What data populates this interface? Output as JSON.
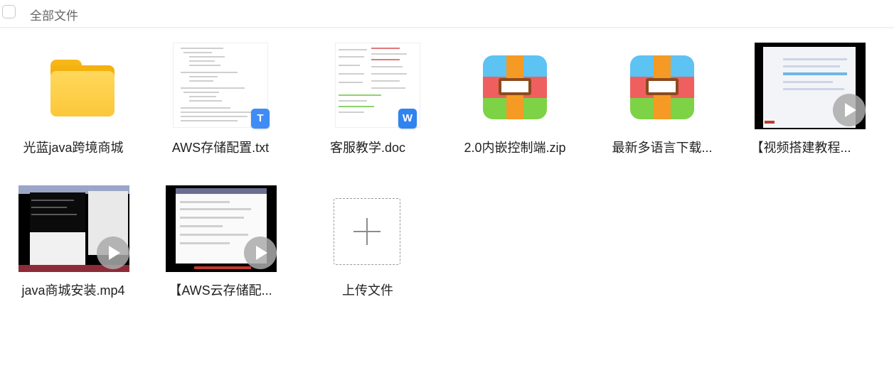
{
  "header": {
    "title": "全部文件"
  },
  "files": [
    {
      "name": "光蓝java跨境商城",
      "type": "folder",
      "icon": "folder-icon"
    },
    {
      "name": "AWS存储配置.txt",
      "type": "txt",
      "badge": "T"
    },
    {
      "name": "客服教学.doc",
      "type": "doc",
      "badge": "W"
    },
    {
      "name": "2.0内嵌控制端.zip",
      "type": "zip",
      "icon": "zip-icon"
    },
    {
      "name": "最新多语言下载...",
      "type": "zip",
      "icon": "zip-icon"
    },
    {
      "name": "【视频搭建教程...",
      "type": "video",
      "icon": "play-icon"
    },
    {
      "name": "java商城安装.mp4",
      "type": "video",
      "icon": "play-icon"
    },
    {
      "name": "【AWS云存储配...",
      "type": "video",
      "icon": "play-icon"
    }
  ],
  "upload": {
    "label": "上传文件"
  },
  "colors": {
    "folder": "#fcc73a",
    "badge_blue": "#3f8cf6",
    "zip_orange": "#f59a24",
    "zip_red": "#ef5f5f",
    "zip_green": "#7ed246",
    "zip_blue": "#5dc3f3"
  }
}
